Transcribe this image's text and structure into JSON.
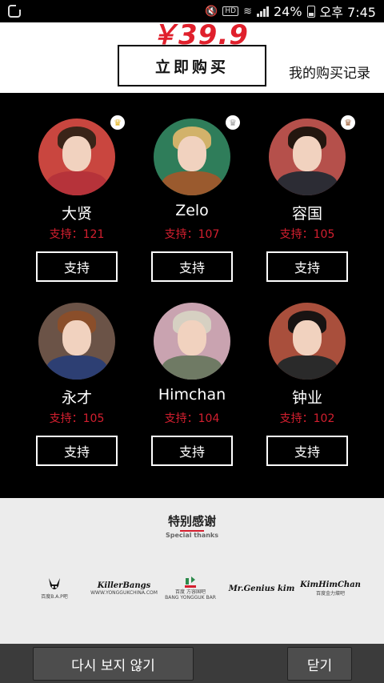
{
  "status_bar": {
    "battery": "24%",
    "time": "오후 7:45",
    "hd_label": "HD"
  },
  "top": {
    "price": "￥39.9",
    "buy_button": "立即购买",
    "records_link": "我的购买记录"
  },
  "members": [
    {
      "name": "大贤",
      "support": "支持：121",
      "button": "支持",
      "crown": "gold",
      "colors": {
        "bg": "#c9463f",
        "hair": "#3a2418",
        "body": "#b6333a"
      }
    },
    {
      "name": "Zelo",
      "support": "支持：107",
      "button": "支持",
      "crown": "silver",
      "colors": {
        "bg": "#2f7d5a",
        "hair": "#d2b26a",
        "body": "#9a5a2e"
      }
    },
    {
      "name": "容国",
      "support": "支持：105",
      "button": "支持",
      "crown": "bronze",
      "colors": {
        "bg": "#b5504b",
        "hair": "#23160f",
        "body": "#2c2c34"
      }
    },
    {
      "name": "永才",
      "support": "支持：105",
      "button": "支持",
      "crown": "",
      "colors": {
        "bg": "#6b5347",
        "hair": "#8a4e2a",
        "body": "#2d3f73"
      }
    },
    {
      "name": "Himchan",
      "support": "支持：104",
      "button": "支持",
      "crown": "",
      "colors": {
        "bg": "#c9a3b0",
        "hair": "#d6d0c2",
        "body": "#6f7a64"
      }
    },
    {
      "name": "钟业",
      "support": "支持：102",
      "button": "支持",
      "crown": "",
      "colors": {
        "bg": "#a94f3c",
        "hair": "#181312",
        "body": "#2a2a2a"
      }
    }
  ],
  "thanks": {
    "title": "特别感谢",
    "subtitle": "Special thanks",
    "sponsors": [
      {
        "name": "百度B.A.P吧",
        "tag": ""
      },
      {
        "name": "KillerBangs",
        "tag": "WWW.YONGGUKCHINA.COM"
      },
      {
        "name": "百度 方容国吧",
        "tag": "BANG YONGGUK BAR"
      },
      {
        "name": "Mr.Genius kim",
        "tag": ""
      },
      {
        "name": "KimHimChan",
        "tag": "百度金力燦吧"
      }
    ]
  },
  "bottom_bar": {
    "dont_show": "다시 보지 않기",
    "close": "닫기"
  }
}
